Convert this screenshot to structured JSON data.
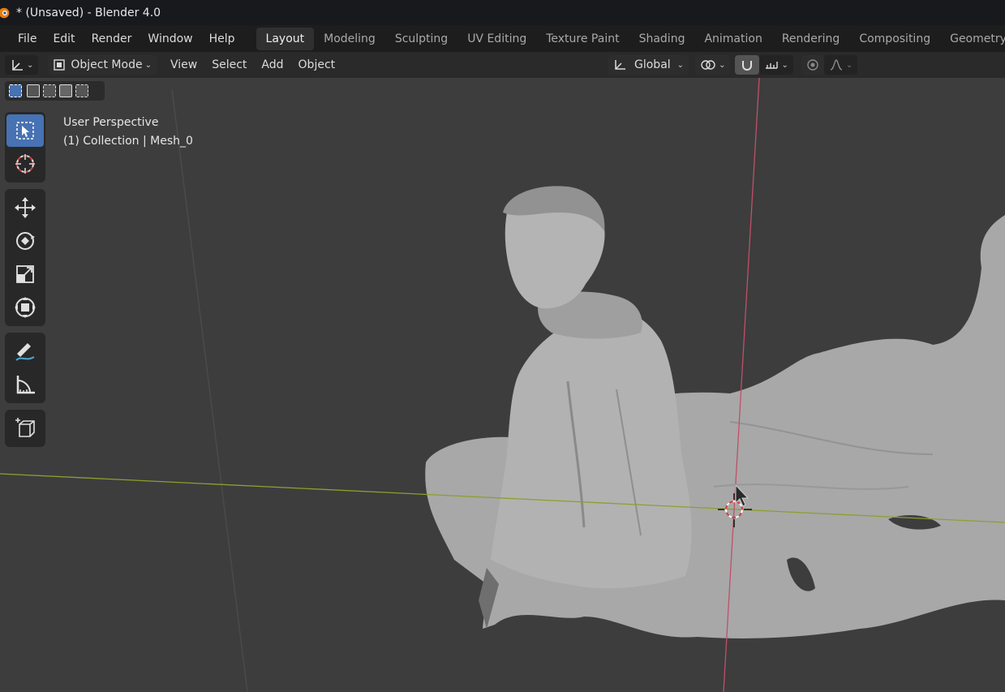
{
  "window": {
    "title": "* (Unsaved) - Blender 4.0"
  },
  "menu": [
    "File",
    "Edit",
    "Render",
    "Window",
    "Help"
  ],
  "workspaces": {
    "active": "Layout",
    "tabs": [
      "Layout",
      "Modeling",
      "Sculpting",
      "UV Editing",
      "Texture Paint",
      "Shading",
      "Animation",
      "Rendering",
      "Compositing",
      "Geometry"
    ]
  },
  "header": {
    "mode": "Object Mode",
    "menus": [
      "View",
      "Select",
      "Add",
      "Object"
    ],
    "transform_orientation": "Global"
  },
  "viewport": {
    "view_name": "User Perspective",
    "collection_info": "(1) Collection | Mesh_0"
  },
  "tools": [
    {
      "name": "select-box-icon",
      "active": true
    },
    {
      "name": "cursor-icon"
    },
    {
      "name": "move-icon"
    },
    {
      "name": "rotate-icon"
    },
    {
      "name": "scale-icon"
    },
    {
      "name": "transform-icon"
    },
    {
      "name": "annotate-icon"
    },
    {
      "name": "measure-icon"
    },
    {
      "name": "add-cube-icon"
    }
  ],
  "colors": {
    "accent": "#4772b3",
    "x_axis": "#c0506a",
    "y_axis": "#8aa030",
    "mesh": "#a9a9a9"
  }
}
